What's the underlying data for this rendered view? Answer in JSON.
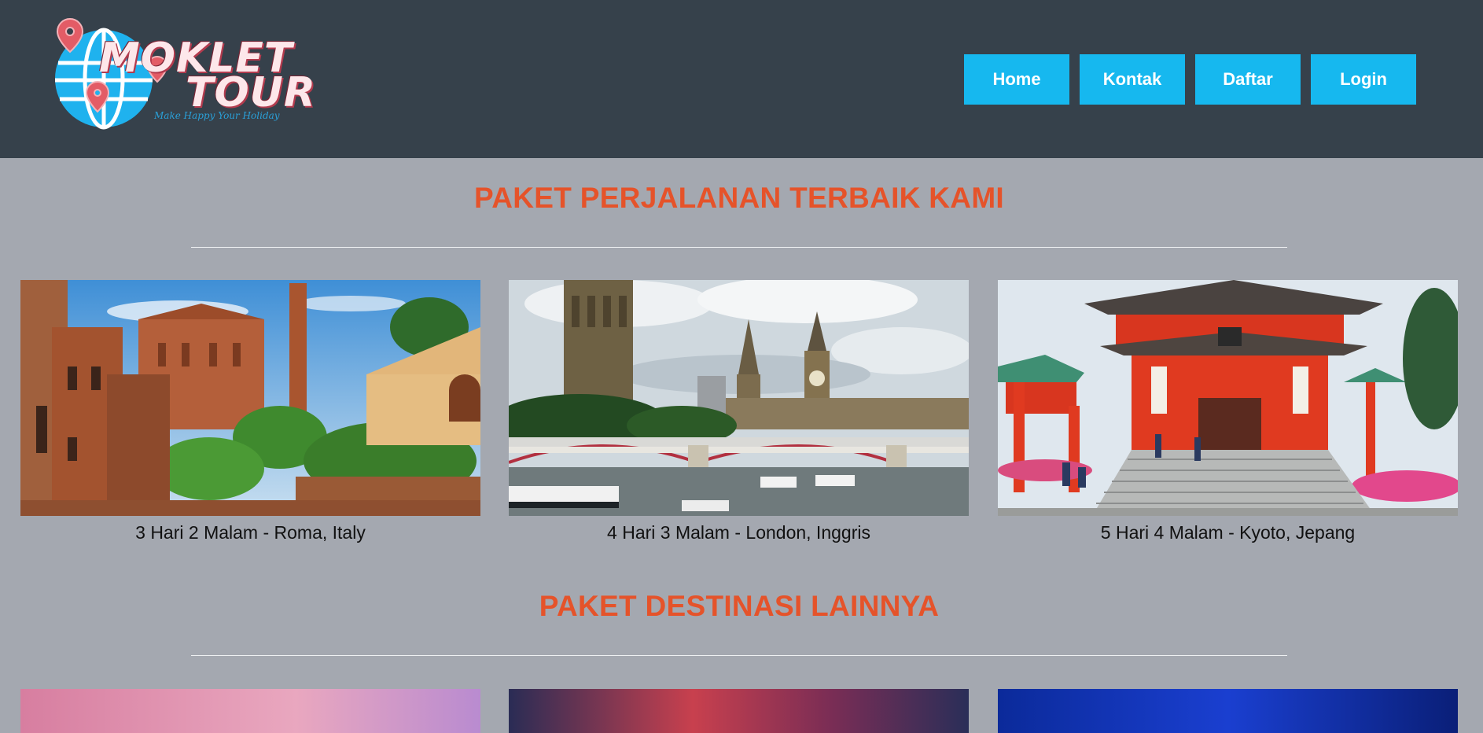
{
  "brand": {
    "line1": "MOKLET",
    "line2": "TOUR",
    "tagline": "Make Happy Your Holiday"
  },
  "nav": [
    {
      "label": "Home"
    },
    {
      "label": "Kontak"
    },
    {
      "label": "Daftar"
    },
    {
      "label": "Login"
    }
  ],
  "sections": {
    "best": {
      "title": "PAKET PERJALANAN TERBAIK KAMI"
    },
    "other": {
      "title": "PAKET DESTINASI LAINNYA"
    }
  },
  "packages": [
    {
      "caption": "3 Hari 2 Malam - Roma, Italy",
      "image": "siena-street-cathedral-photo"
    },
    {
      "caption": "4 Hari 3 Malam - London, Inggris",
      "image": "london-thames-big-ben-photo"
    },
    {
      "caption": "5 Hari 4 Malam - Kyoto, Jepang",
      "image": "kyoto-fushimi-inari-gate-photo"
    }
  ],
  "other_thumbs": [
    "pink-sky-photo",
    "red-cloud-sunset-photo",
    "blue-night-sky-photo"
  ],
  "colors": {
    "header_bg": "#36414b",
    "page_bg": "#a4a8b0",
    "nav_button": "#16b8ef",
    "section_title": "#e5532a"
  }
}
